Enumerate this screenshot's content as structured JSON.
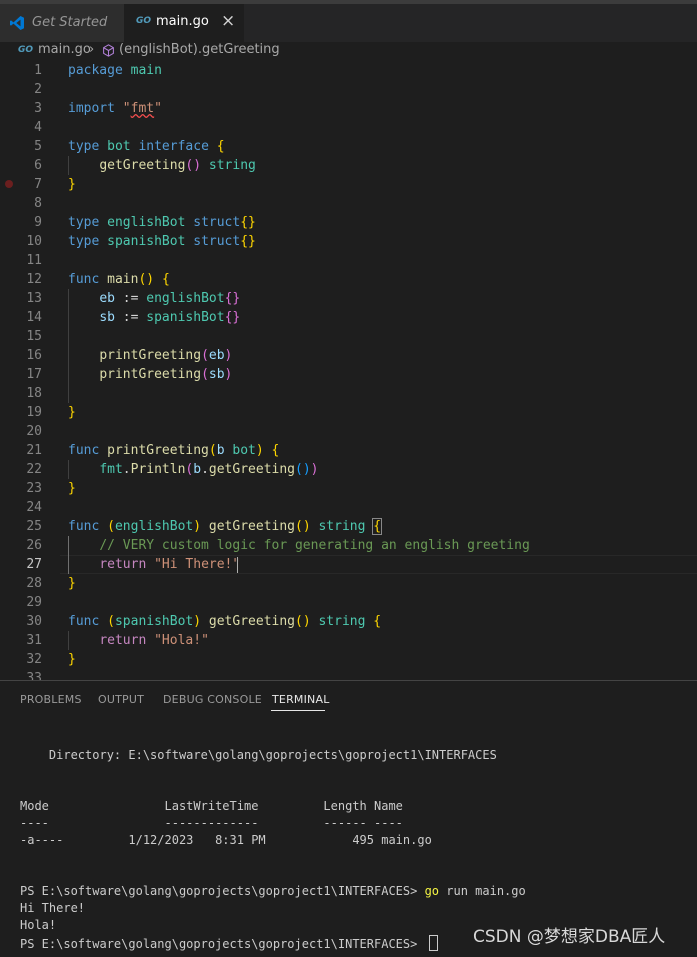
{
  "tabs": [
    {
      "label": "Get Started",
      "icon": "vscode-logo-icon"
    },
    {
      "label": "main.go",
      "icon": "go-file-icon",
      "icon_text": "GO"
    }
  ],
  "breadcrumb": {
    "file": "main.go",
    "separator": "›",
    "symbol": "(englishBot).getGreeting"
  },
  "editor": {
    "line_numbers": [
      "1",
      "2",
      "3",
      "4",
      "5",
      "6",
      "7",
      "8",
      "9",
      "10",
      "11",
      "12",
      "13",
      "14",
      "15",
      "16",
      "17",
      "18",
      "19",
      "20",
      "21",
      "22",
      "23",
      "24",
      "25",
      "26",
      "27",
      "28",
      "29",
      "30",
      "31",
      "32",
      "33"
    ],
    "current_line": 27,
    "breakpoint_line": 7
  },
  "panel": {
    "tabs": [
      "PROBLEMS",
      "OUTPUT",
      "DEBUG CONSOLE",
      "TERMINAL"
    ],
    "active_tab": "TERMINAL",
    "terminal": {
      "directory": "    Directory: E:\\software\\golang\\goprojects\\goproject1\\INTERFACES",
      "header": "Mode                LastWriteTime         Length Name",
      "divider": "----                -------------         ------ ----",
      "row": "-a----         1/12/2023   8:31 PM            495 main.go",
      "prompt": "PS E:\\software\\golang\\goprojects\\goproject1\\INTERFACES> ",
      "cmd": "go",
      "cmd_args": " run main.go",
      "out1": "Hi There!",
      "out2": "Hola!",
      "prompt2": "PS E:\\software\\golang\\goprojects\\goproject1\\INTERFACES> "
    }
  },
  "watermark": "CSDN @梦想家DBA匠人",
  "colors": {
    "background": "#1e1e1e",
    "keyword": "#569cd6",
    "type": "#4ec9b0",
    "function": "#dcdcaa",
    "variable": "#9cdcfe",
    "string": "#ce9178",
    "comment": "#6a9955",
    "bracket_gold": "#ffd700",
    "bracket_purple": "#da70d6",
    "bracket_blue": "#179fff"
  }
}
